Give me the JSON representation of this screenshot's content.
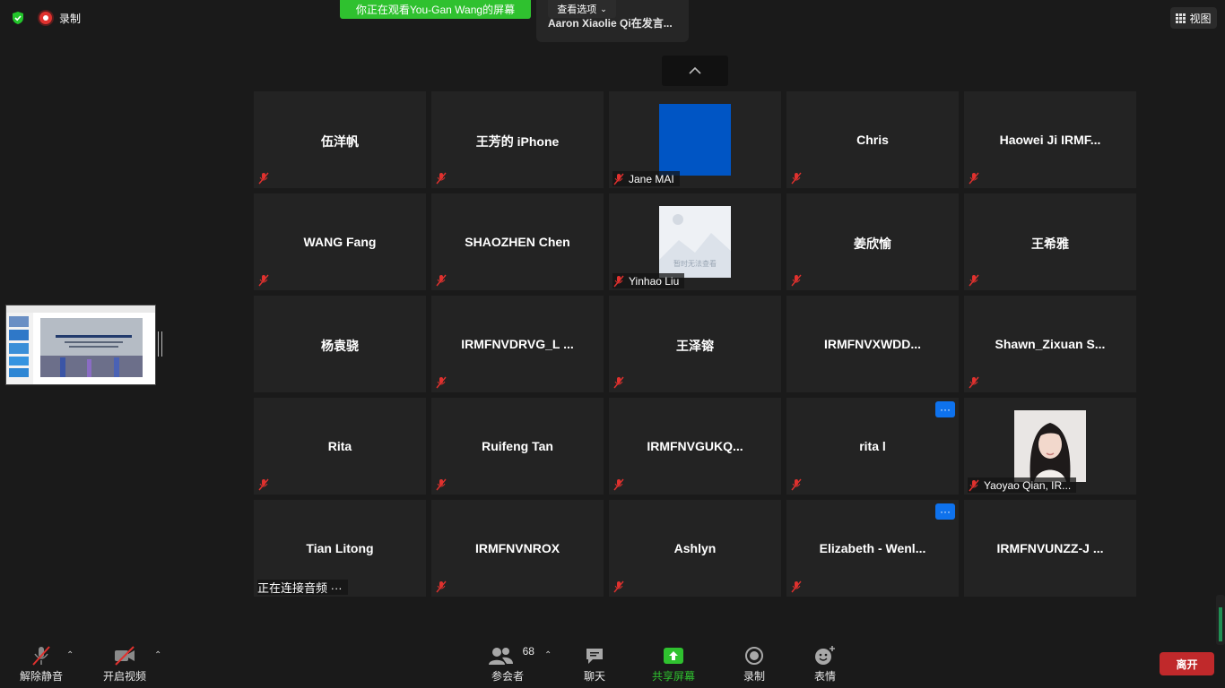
{
  "top": {
    "record_label": "录制",
    "share_banner": "你正在观看You-Gan Wang的屏幕",
    "view_options": "查看选项",
    "speaker_text": "Aaron Xiaolie Qi在发言...",
    "view_button": "视图"
  },
  "tiles": [
    {
      "name": "伍洋帆"
    },
    {
      "name": "王芳的 iPhone"
    },
    {
      "name": "Jane MAI",
      "avatar": "blue"
    },
    {
      "name": "Chris"
    },
    {
      "name": "Haowei Ji IRMF..."
    },
    {
      "name": "WANG Fang"
    },
    {
      "name": "SHAOZHEN Chen"
    },
    {
      "name": "Yinhao Liu",
      "avatar": "placeholder",
      "avatar_text": "暂时无法查看"
    },
    {
      "name": "姜欣愉"
    },
    {
      "name": "王希雅"
    },
    {
      "name": "杨袁骁"
    },
    {
      "name": "IRMFNVDRVG_L ..."
    },
    {
      "name": "王泽镕"
    },
    {
      "name": "IRMFNVXWDD..."
    },
    {
      "name": "Shawn_Zixuan  S..."
    },
    {
      "name": "Rita"
    },
    {
      "name": "Ruifeng Tan"
    },
    {
      "name": "IRMFNVGUKQ..."
    },
    {
      "name": "rita l",
      "more": "···"
    },
    {
      "name": "Yaoyao Qian, IR...",
      "avatar": "photo"
    },
    {
      "name": "Tian Litong",
      "status": "正在连接音频 ···"
    },
    {
      "name": "IRMFNVNROX"
    },
    {
      "name": "Ashlyn"
    },
    {
      "name": "Elizabeth  - Wenl...",
      "more": "···"
    },
    {
      "name": "IRMFNVUNZZ-J ..."
    }
  ],
  "toolbar": {
    "unmute": "解除静音",
    "start_video": "开启视频",
    "participants": "参会者",
    "participants_count": "68",
    "chat": "聊天",
    "share_screen": "共享屏幕",
    "record": "录制",
    "reactions": "表情",
    "leave": "离开"
  },
  "colors": {
    "share_green": "#2fc12f",
    "leave_red": "#c0292b",
    "accent_blue": "#0e72ed",
    "mute_red": "#e0312e"
  }
}
